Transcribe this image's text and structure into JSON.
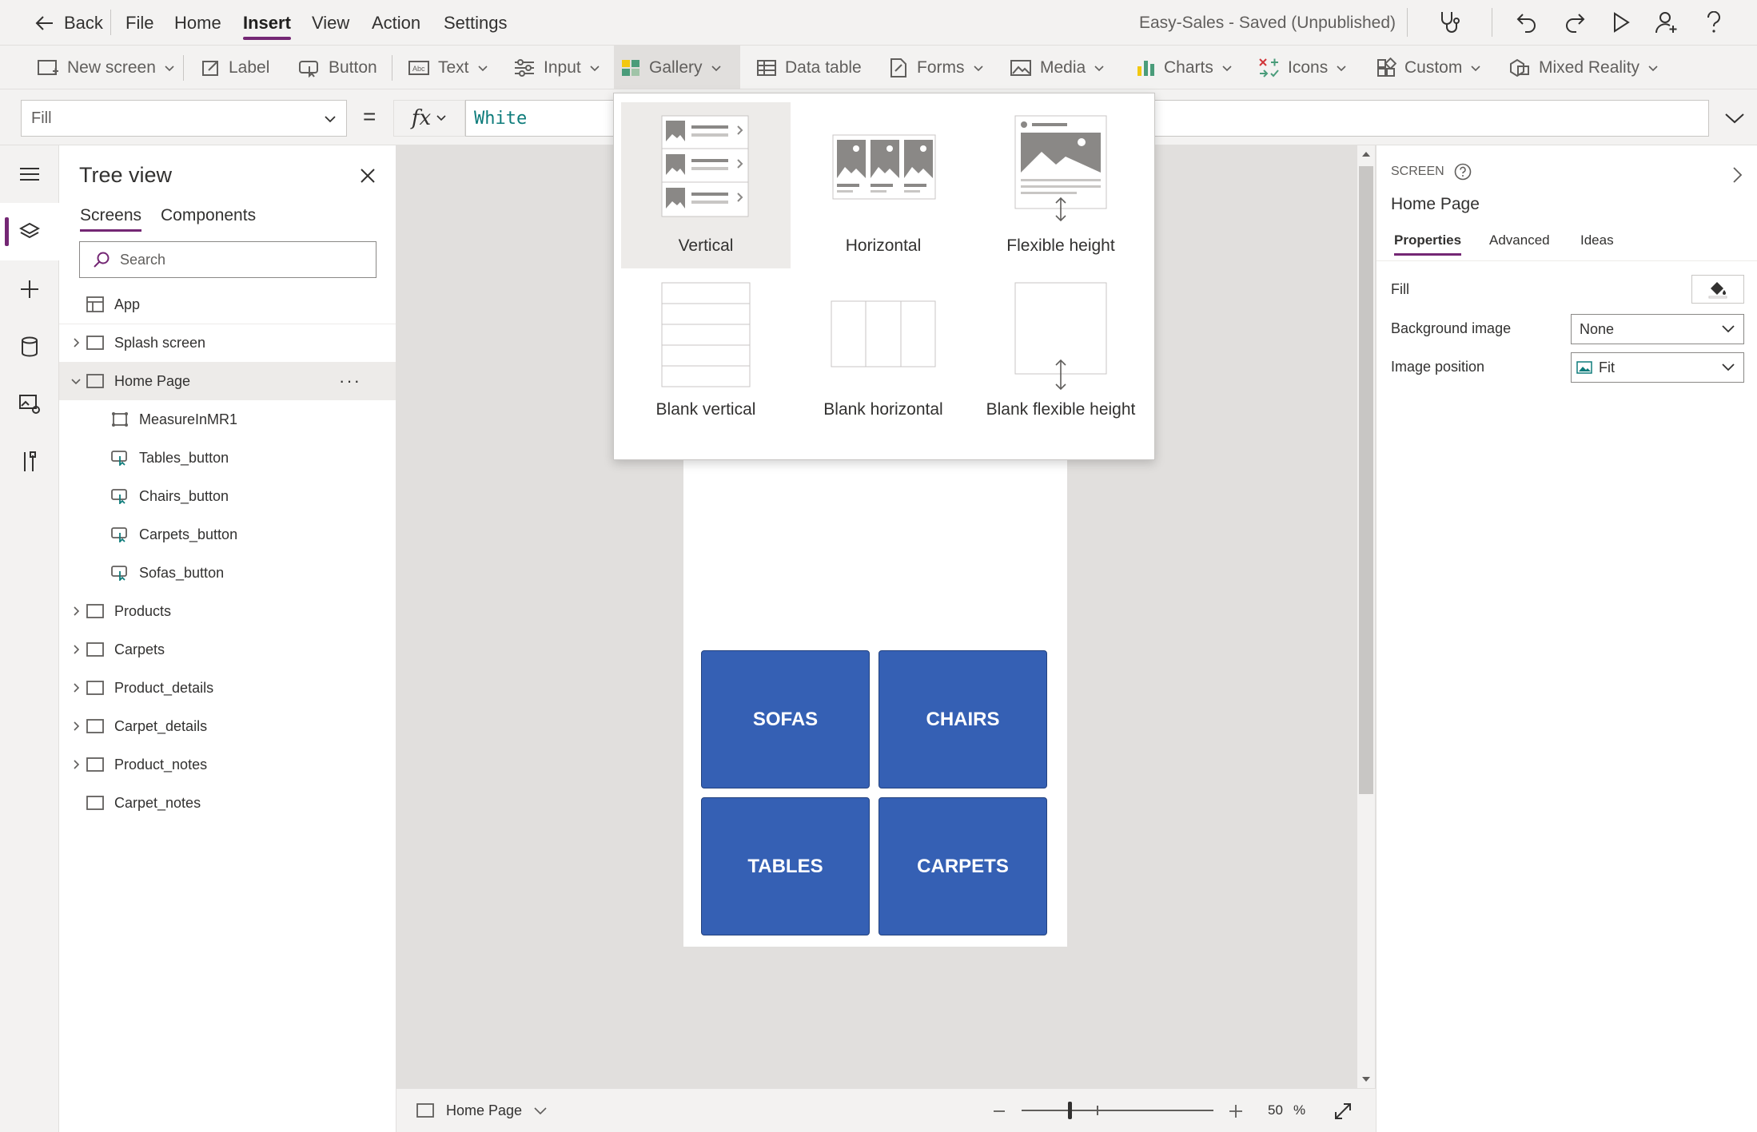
{
  "menubar": {
    "back_label": "Back",
    "items": [
      "File",
      "Home",
      "Insert",
      "View",
      "Action",
      "Settings"
    ],
    "active_item": "Insert",
    "app_status": "Easy-Sales - Saved (Unpublished)"
  },
  "ribbon": {
    "items": [
      "New screen",
      "Label",
      "Button",
      "Text",
      "Input",
      "Gallery",
      "Data table",
      "Forms",
      "Media",
      "Charts",
      "Icons",
      "Custom",
      "Mixed Reality"
    ],
    "active_item": "Gallery"
  },
  "formula": {
    "property": "Fill",
    "fx_label": "fx",
    "value": "White"
  },
  "tree_view": {
    "title": "Tree view",
    "tabs": [
      "Screens",
      "Components"
    ],
    "active_tab": "Screens",
    "search_placeholder": "Search",
    "app_label": "App",
    "nodes": {
      "splash": "Splash screen",
      "home": "Home Page",
      "home_children": [
        "MeasureInMR1",
        "Tables_button",
        "Chairs_button",
        "Carpets_button",
        "Sofas_button"
      ],
      "products": "Products",
      "carpets": "Carpets",
      "product_details": "Product_details",
      "carpet_details": "Carpet_details",
      "product_notes": "Product_notes",
      "carpet_notes": "Carpet_notes"
    },
    "more_glyph": "···"
  },
  "gallery_menu": {
    "options": [
      "Vertical",
      "Horizontal",
      "Flexible height",
      "Blank vertical",
      "Blank horizontal",
      "Blank flexible height"
    ],
    "selected": "Vertical"
  },
  "canvas": {
    "tiles": [
      "SOFAS",
      "CHAIRS",
      "TABLES",
      "CARPETS"
    ],
    "tile_color": "#3560b4"
  },
  "statusbar": {
    "screen_name": "Home Page",
    "zoom_value": "50",
    "zoom_unit": "%"
  },
  "right_panel": {
    "section": "SCREEN",
    "screen_name": "Home Page",
    "tabs": [
      "Properties",
      "Advanced",
      "Ideas"
    ],
    "active_tab": "Properties",
    "fill_label": "Fill",
    "background_image_label": "Background image",
    "background_image_value": "None",
    "image_position_label": "Image position",
    "image_position_value": "Fit"
  },
  "colors": {
    "accent": "#742774",
    "formula_text": "#0e7c7b",
    "chrome": "#f3f2f1",
    "canvas_bg": "#e1dfdd"
  }
}
